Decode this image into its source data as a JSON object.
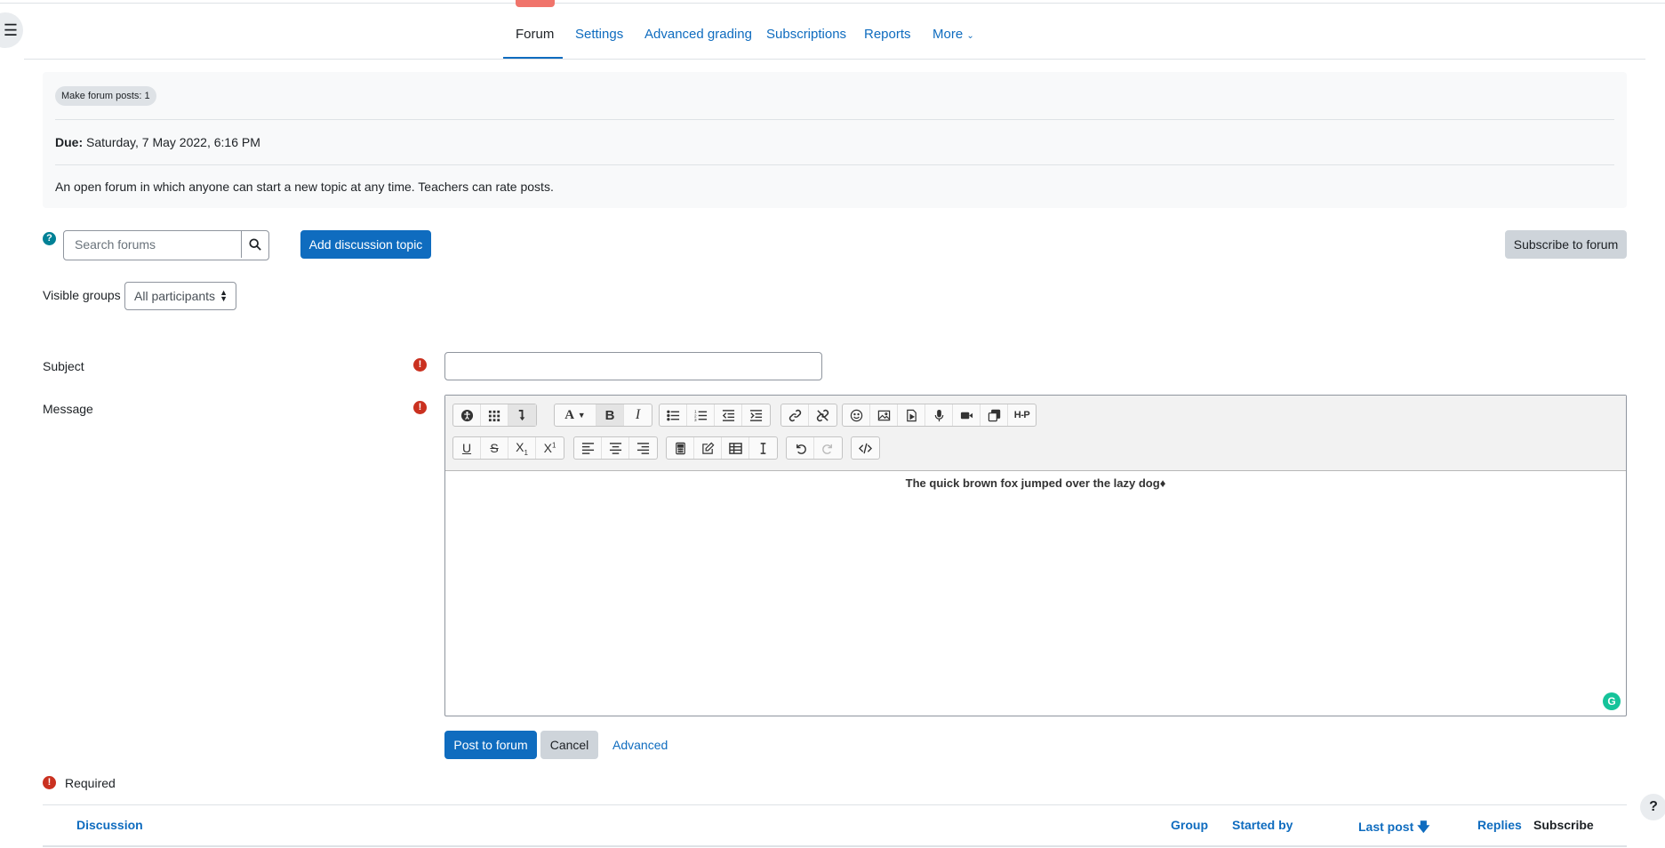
{
  "nav": {
    "items": [
      {
        "label": "Forum",
        "active": true
      },
      {
        "label": "Settings"
      },
      {
        "label": "Advanced grading"
      },
      {
        "label": "Subscriptions"
      },
      {
        "label": "Reports"
      },
      {
        "label": "More"
      }
    ]
  },
  "activity": {
    "badge": "Make forum posts: 1",
    "due_label": "Due:",
    "due_value": "Saturday, 7 May 2022, 6:16 PM",
    "description": "An open forum in which anyone can start a new topic at any time. Teachers can rate posts."
  },
  "search": {
    "placeholder": "Search forums"
  },
  "buttons": {
    "add_discussion": "Add discussion topic",
    "subscribe": "Subscribe to forum",
    "post": "Post to forum",
    "cancel": "Cancel",
    "advanced": "Advanced"
  },
  "groups": {
    "label": "Visible groups",
    "selected": "All participants"
  },
  "form": {
    "subject_label": "Subject",
    "subject_value": "",
    "message_label": "Message",
    "message_content": "The quick brown fox jumped over the lazy dog♦",
    "required_label": "Required"
  },
  "table": {
    "headers": [
      "Discussion",
      "Group",
      "Started by",
      "Last post",
      "Replies",
      "Subscribe"
    ]
  },
  "colors": {
    "primary": "#0f6cbf",
    "required": "#ca3120",
    "info": "#008196"
  }
}
